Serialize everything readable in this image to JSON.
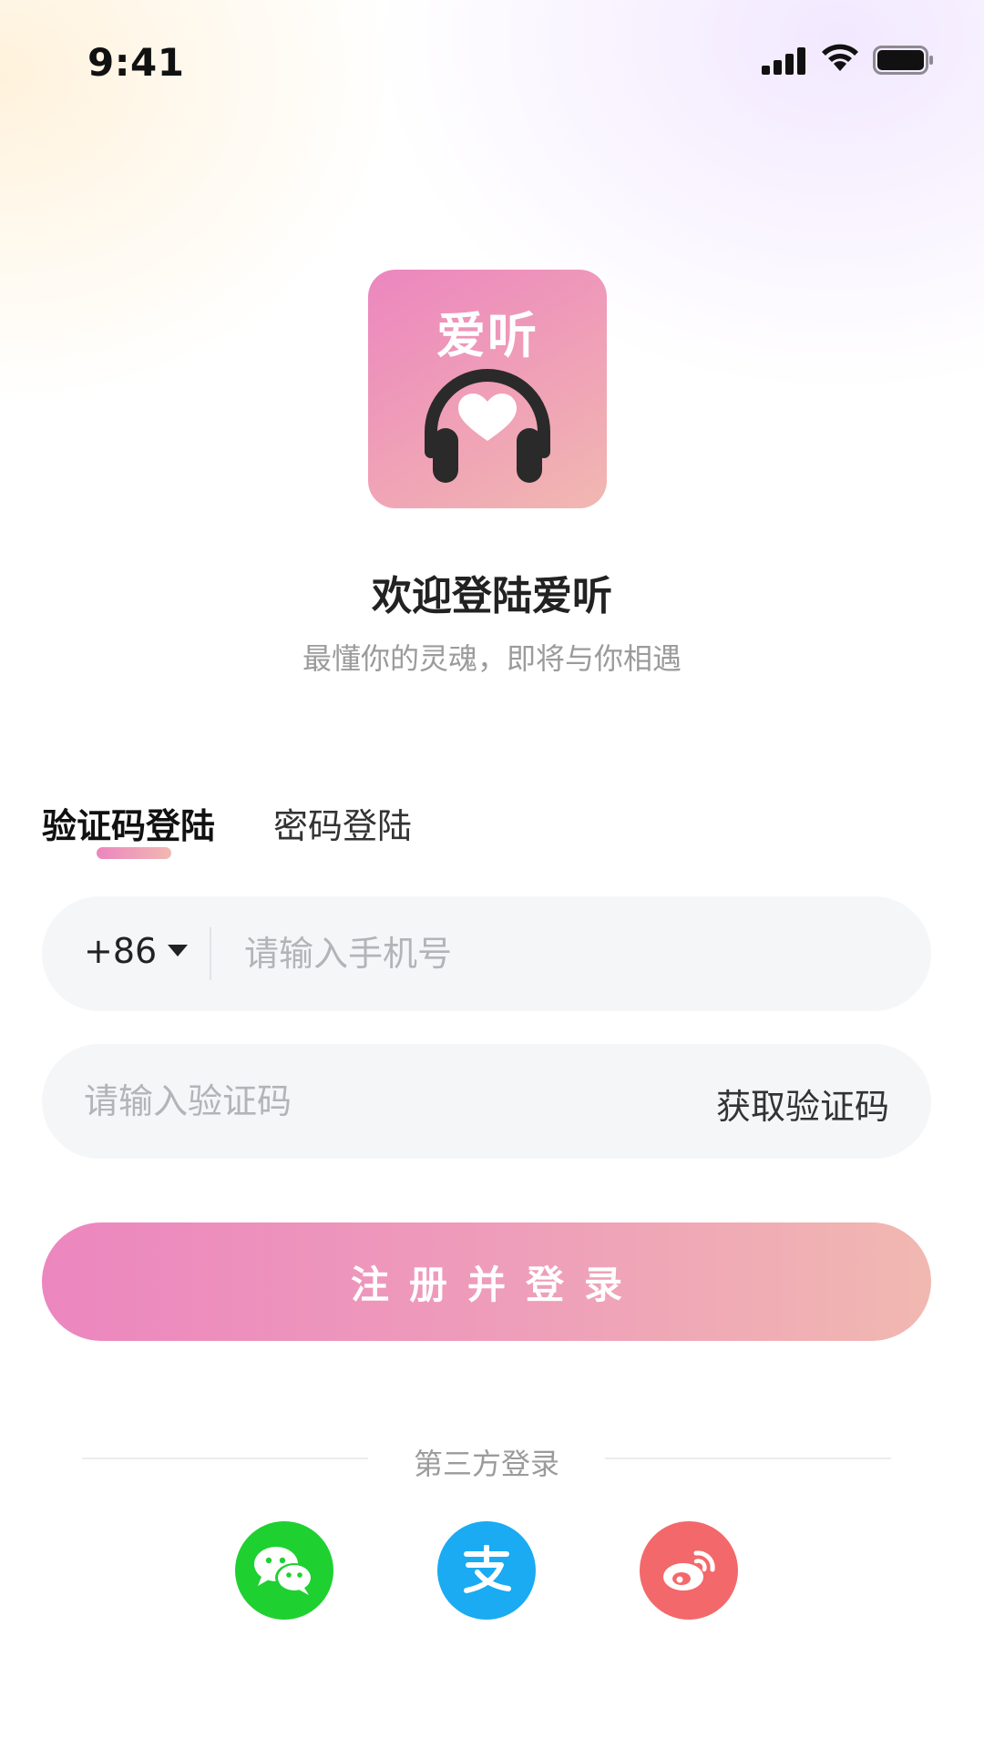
{
  "status_bar": {
    "time": "9:41"
  },
  "app": {
    "logo_text": "爱听",
    "welcome_title": "欢迎登陆爱听",
    "welcome_subtitle": "最懂你的灵魂，即将与你相遇"
  },
  "tabs": [
    {
      "label": "验证码登陆",
      "active": true
    },
    {
      "label": "密码登陆",
      "active": false
    }
  ],
  "form": {
    "country_code": "+86",
    "phone_placeholder": "请输入手机号",
    "code_placeholder": "请输入验证码",
    "get_code_label": "获取验证码",
    "submit_label": "注册并登录"
  },
  "third_party": {
    "label": "第三方登录",
    "providers": [
      "wechat-icon",
      "alipay-icon",
      "weibo-icon"
    ]
  },
  "colors": {
    "accent_start": "#ec86bf",
    "accent_end": "#f1b8b1",
    "wechat": "#1fd031",
    "alipay": "#1aabf2",
    "weibo": "#f3686a"
  }
}
